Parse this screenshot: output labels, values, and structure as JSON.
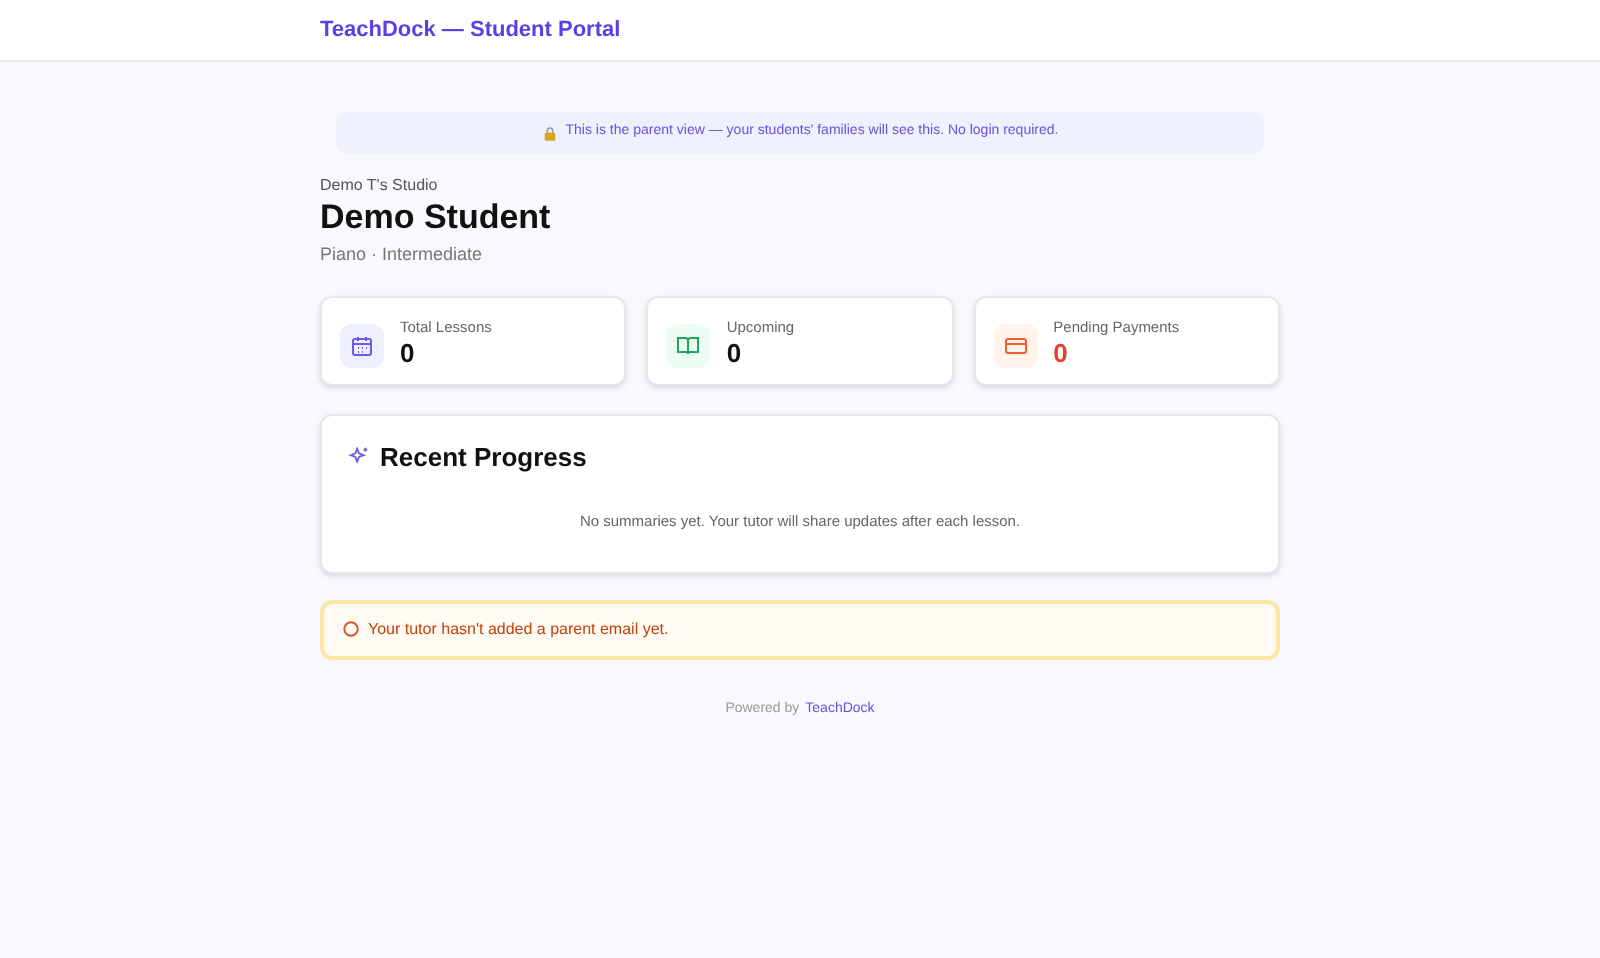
{
  "header": {
    "title": "TeachDock — Student Portal"
  },
  "banner": {
    "text": "This is the parent view — your students' families will see this. No login required."
  },
  "student": {
    "studio": "Demo T's Studio",
    "name": "Demo Student",
    "details": "Piano · Intermediate"
  },
  "stats": [
    {
      "kind": "lessons",
      "label": "Total Lessons",
      "value": "0"
    },
    {
      "kind": "upcoming",
      "label": "Upcoming",
      "value": "0"
    },
    {
      "kind": "payments",
      "label": "Pending Payments",
      "value": "0"
    }
  ],
  "progress": {
    "title": "Recent Progress",
    "empty_text": "No summaries yet. Your tutor will share updates after each lesson."
  },
  "notice": {
    "text": "Your tutor hasn't added a parent email yet."
  },
  "footer": {
    "prefix": "Powered by",
    "link": "TeachDock"
  }
}
